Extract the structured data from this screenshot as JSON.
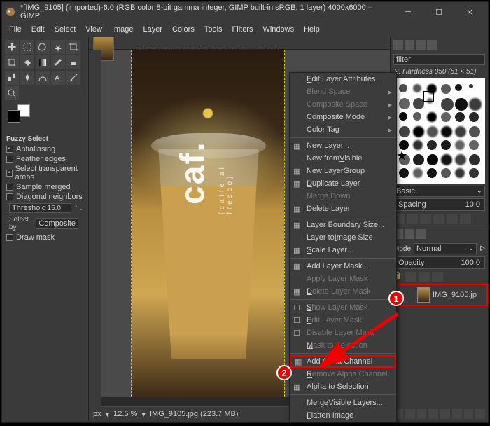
{
  "title": "*[IMG_9105] (imported)-6.0 (RGB color 8-bit gamma integer, GIMP built-in sRGB, 1 layer) 4000x6000 – GIMP",
  "menubar": [
    "File",
    "Edit",
    "Select",
    "View",
    "Image",
    "Layer",
    "Colors",
    "Tools",
    "Filters",
    "Windows",
    "Help"
  ],
  "tool_options": {
    "title": "Fuzzy Select",
    "opts": [
      {
        "label": "Antialiasing",
        "on": true
      },
      {
        "label": "Feather edges",
        "on": false
      },
      {
        "label": "Select transparent areas",
        "on": true
      },
      {
        "label": "Sample merged",
        "on": false
      },
      {
        "label": "Diagonal neighbors",
        "on": false
      }
    ],
    "threshold_label": "Threshold",
    "threshold_val": "15.0",
    "selectby_label": "Select by",
    "selectby_val": "Composite",
    "drawmask": {
      "label": "Draw mask",
      "on": false
    }
  },
  "status": {
    "unit": "px",
    "zoom": "12.5 %",
    "file": "IMG_9105.jpg (223.7 MB)"
  },
  "brush": {
    "filter_placeholder": "filter",
    "header": "2. Hardness 050 (51 × 51)",
    "preset": "Basic,",
    "spacing_label": "Spacing",
    "spacing_val": "10.0"
  },
  "layers": {
    "mode_label": "Mode",
    "mode_val": "Normal",
    "opacity_label": "Opacity",
    "opacity_val": "100.0",
    "layer_name": "IMG_9105.jp"
  },
  "ctx": {
    "items": [
      {
        "t": "Edit Layer Attributes...",
        "u": "E"
      },
      {
        "t": "Blend Space",
        "sub": true,
        "dis": true
      },
      {
        "t": "Composite Space",
        "sub": true,
        "dis": true
      },
      {
        "t": "Composite Mode",
        "sub": true
      },
      {
        "t": "Color Tag",
        "sub": true
      },
      {
        "sep": true
      },
      {
        "t": "New Layer...",
        "ico": true,
        "u": "N"
      },
      {
        "t": "New from Visible",
        "u": "V"
      },
      {
        "t": "New Layer Group",
        "ico": true,
        "u": "G"
      },
      {
        "t": "Duplicate Layer",
        "ico": true,
        "u": "D"
      },
      {
        "t": "Merge Down",
        "dis": true
      },
      {
        "t": "Delete Layer",
        "ico": true,
        "u": "D"
      },
      {
        "sep": true
      },
      {
        "t": "Layer Boundary Size...",
        "ico": true,
        "u": "L"
      },
      {
        "t": "Layer to Image Size",
        "u": "I"
      },
      {
        "t": "Scale Layer...",
        "ico": true,
        "u": "S"
      },
      {
        "sep": true
      },
      {
        "t": "Add Layer Mask...",
        "ico": true
      },
      {
        "t": "Apply Layer Mask",
        "dis": true
      },
      {
        "t": "Delete Layer Mask",
        "ico": true,
        "dis": true,
        "u": "D"
      },
      {
        "sep": true
      },
      {
        "t": "Show Layer Mask",
        "dis": true,
        "cb": true,
        "u": "S"
      },
      {
        "t": "Edit Layer Mask",
        "dis": true,
        "cb": true,
        "u": "E"
      },
      {
        "t": "Disable Layer Mask",
        "dis": true,
        "cb": true
      },
      {
        "t": "Mask to Selection",
        "dis": true,
        "u": "M"
      },
      {
        "sep": true
      },
      {
        "t": "Add Alpha Channel",
        "sel": true,
        "ico": true
      },
      {
        "t": "Remove Alpha Channel",
        "dis": true,
        "u": "R"
      },
      {
        "t": "Alpha to Selection",
        "ico": true,
        "u": "A"
      },
      {
        "sep": true
      },
      {
        "t": "Merge Visible Layers...",
        "u": "V"
      },
      {
        "t": "Flatten Image",
        "u": "F"
      }
    ]
  },
  "image_text": {
    "brand": "caf.",
    "tagline": "[caffe al fresco]"
  }
}
